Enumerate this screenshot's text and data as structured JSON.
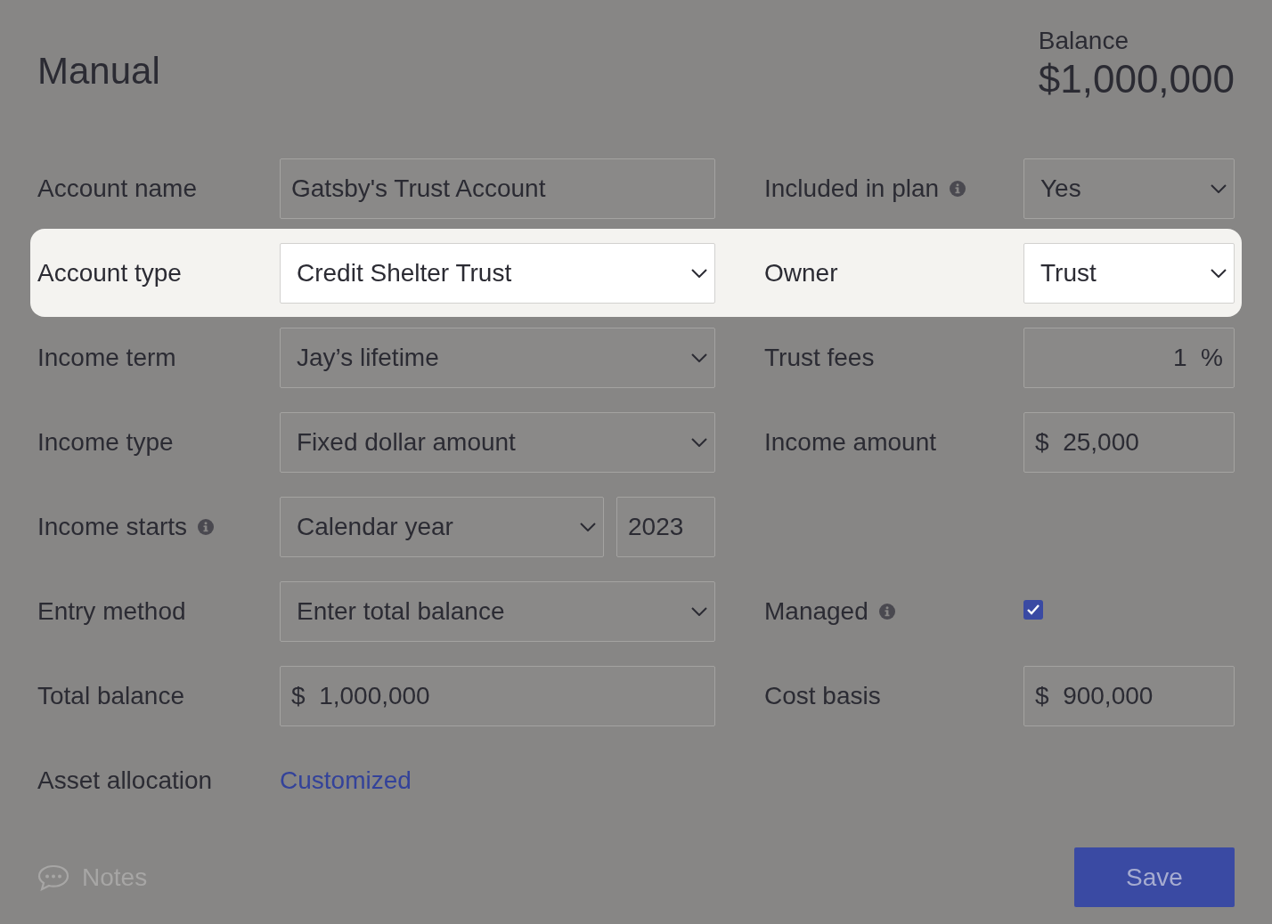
{
  "header": {
    "title": "Manual",
    "balance_label": "Balance",
    "balance_value": "$1,000,000"
  },
  "rows": [
    {
      "highlighted": false,
      "left": {
        "label": "Account name",
        "info": false,
        "field": {
          "kind": "text",
          "value": "Gatsby's Trust Account"
        }
      },
      "right": {
        "label": "Included in plan",
        "info": true,
        "field": {
          "kind": "select",
          "value": "Yes"
        }
      }
    },
    {
      "highlighted": true,
      "left": {
        "label": "Account type",
        "info": false,
        "field": {
          "kind": "select",
          "value": "Credit Shelter Trust"
        }
      },
      "right": {
        "label": "Owner",
        "info": false,
        "field": {
          "kind": "select",
          "value": "Trust"
        }
      }
    },
    {
      "highlighted": false,
      "left": {
        "label": "Income term",
        "info": false,
        "field": {
          "kind": "select",
          "value": "Jay’s lifetime"
        }
      },
      "right": {
        "label": "Trust fees",
        "info": false,
        "field": {
          "kind": "percent",
          "value": "1",
          "suffix": "%"
        }
      }
    },
    {
      "highlighted": false,
      "left": {
        "label": "Income type",
        "info": false,
        "field": {
          "kind": "select",
          "value": "Fixed dollar amount"
        }
      },
      "right": {
        "label": "Income amount",
        "info": false,
        "field": {
          "kind": "currency",
          "prefix": "$",
          "value": "25,000"
        }
      }
    },
    {
      "highlighted": false,
      "left": {
        "label": "Income starts",
        "info": true,
        "field": {
          "kind": "select-year",
          "value": "Calendar year",
          "year": "2023"
        }
      }
    },
    {
      "highlighted": false,
      "left": {
        "label": "Entry method",
        "info": false,
        "field": {
          "kind": "select",
          "value": "Enter total balance"
        }
      },
      "right": {
        "label": "Managed",
        "info": true,
        "field": {
          "kind": "checkbox",
          "checked": true
        }
      }
    },
    {
      "highlighted": false,
      "left": {
        "label": "Total balance",
        "info": false,
        "field": {
          "kind": "currency",
          "prefix": "$",
          "value": "1,000,000"
        }
      },
      "right": {
        "label": "Cost basis",
        "info": false,
        "field": {
          "kind": "currency",
          "prefix": "$",
          "value": "900,000"
        }
      }
    },
    {
      "highlighted": false,
      "left": {
        "label": "Asset allocation",
        "info": false,
        "field": {
          "kind": "link",
          "value": "Customized"
        }
      }
    }
  ],
  "footer": {
    "notes": "Notes",
    "save": "Save"
  }
}
